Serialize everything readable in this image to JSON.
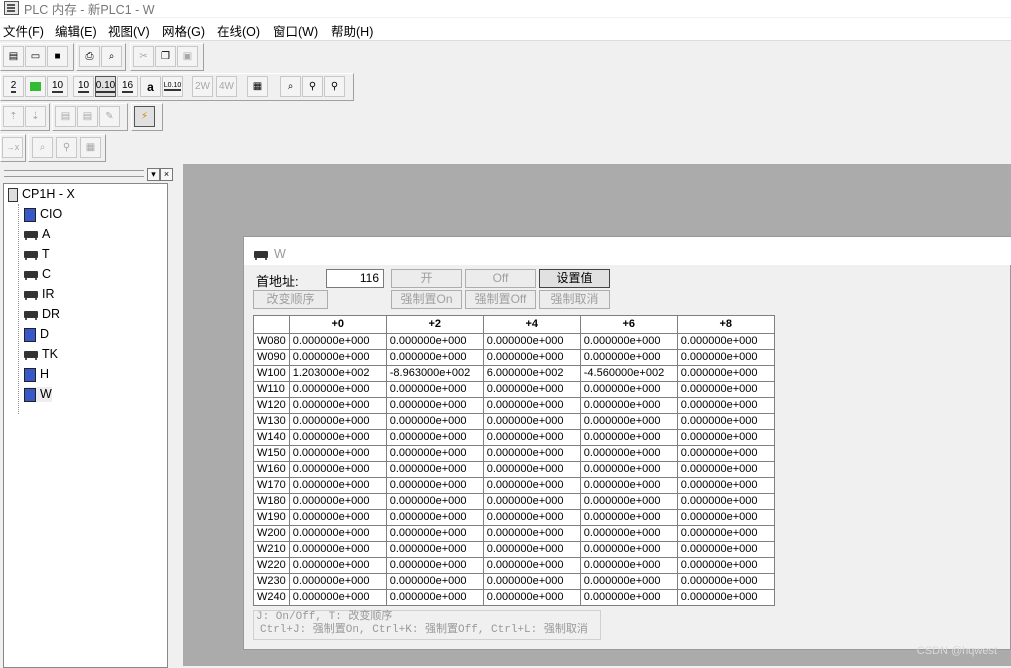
{
  "window": {
    "title": "PLC 内存 - 新PLC1 - W"
  },
  "menu": [
    "文件(F)",
    "编辑(E)",
    "视图(V)",
    "网格(G)",
    "在线(O)",
    "窗口(W)",
    "帮助(H)"
  ],
  "toolbar_row2": {
    "b1": "2",
    "b3": "10",
    "b4": "10",
    "b5": "0.10",
    "b6": "16",
    "b7": "a",
    "b8": "L0.10",
    "b9": "2W",
    "b10": "4W"
  },
  "tree": {
    "root": "CP1H - X",
    "items": [
      "CIO",
      "A",
      "T",
      "C",
      "IR",
      "DR",
      "D",
      "TK",
      "H",
      "W"
    ]
  },
  "child": {
    "title": "W",
    "start_label": "首地址:",
    "start_value": "116",
    "btn_on": "开",
    "btn_off": "Off",
    "btn_set": "设置值",
    "btn_order": "改变顺序",
    "btn_force_on": "强制置On",
    "btn_force_off": "强制置Off",
    "btn_force_cancel": "强制取消"
  },
  "grid": {
    "columns": [
      "+0",
      "+2",
      "+4",
      "+6",
      "+8"
    ],
    "rows": [
      {
        "addr": "W080",
        "v": [
          "0.000000e+000",
          "0.000000e+000",
          "0.000000e+000",
          "0.000000e+000",
          "0.000000e+000"
        ]
      },
      {
        "addr": "W090",
        "v": [
          "0.000000e+000",
          "0.000000e+000",
          "0.000000e+000",
          "0.000000e+000",
          "0.000000e+000"
        ]
      },
      {
        "addr": "W100",
        "v": [
          "1.203000e+002",
          "-8.963000e+002",
          "6.000000e+002",
          "-4.560000e+002",
          "0.000000e+000"
        ]
      },
      {
        "addr": "W110",
        "v": [
          "0.000000e+000",
          "0.000000e+000",
          "0.000000e+000",
          "0.000000e+000",
          "0.000000e+000"
        ]
      },
      {
        "addr": "W120",
        "v": [
          "0.000000e+000",
          "0.000000e+000",
          "0.000000e+000",
          "0.000000e+000",
          "0.000000e+000"
        ]
      },
      {
        "addr": "W130",
        "v": [
          "0.000000e+000",
          "0.000000e+000",
          "0.000000e+000",
          "0.000000e+000",
          "0.000000e+000"
        ]
      },
      {
        "addr": "W140",
        "v": [
          "0.000000e+000",
          "0.000000e+000",
          "0.000000e+000",
          "0.000000e+000",
          "0.000000e+000"
        ]
      },
      {
        "addr": "W150",
        "v": [
          "0.000000e+000",
          "0.000000e+000",
          "0.000000e+000",
          "0.000000e+000",
          "0.000000e+000"
        ]
      },
      {
        "addr": "W160",
        "v": [
          "0.000000e+000",
          "0.000000e+000",
          "0.000000e+000",
          "0.000000e+000",
          "0.000000e+000"
        ]
      },
      {
        "addr": "W170",
        "v": [
          "0.000000e+000",
          "0.000000e+000",
          "0.000000e+000",
          "0.000000e+000",
          "0.000000e+000"
        ]
      },
      {
        "addr": "W180",
        "v": [
          "0.000000e+000",
          "0.000000e+000",
          "0.000000e+000",
          "0.000000e+000",
          "0.000000e+000"
        ]
      },
      {
        "addr": "W190",
        "v": [
          "0.000000e+000",
          "0.000000e+000",
          "0.000000e+000",
          "0.000000e+000",
          "0.000000e+000"
        ]
      },
      {
        "addr": "W200",
        "v": [
          "0.000000e+000",
          "0.000000e+000",
          "0.000000e+000",
          "0.000000e+000",
          "0.000000e+000"
        ]
      },
      {
        "addr": "W210",
        "v": [
          "0.000000e+000",
          "0.000000e+000",
          "0.000000e+000",
          "0.000000e+000",
          "0.000000e+000"
        ]
      },
      {
        "addr": "W220",
        "v": [
          "0.000000e+000",
          "0.000000e+000",
          "0.000000e+000",
          "0.000000e+000",
          "0.000000e+000"
        ]
      },
      {
        "addr": "W230",
        "v": [
          "0.000000e+000",
          "0.000000e+000",
          "0.000000e+000",
          "0.000000e+000",
          "0.000000e+000"
        ]
      },
      {
        "addr": "W240",
        "v": [
          "0.000000e+000",
          "0.000000e+000",
          "0.000000e+000",
          "0.000000e+000",
          "0.000000e+000"
        ]
      }
    ]
  },
  "help": {
    "line1": "J: On/Off,    T: 改变顺序",
    "line2": "Ctrl+J: 强制置On,   Ctrl+K:  强制置Off,   Ctrl+L: 强制取消"
  },
  "watermark": "CSDN @hqwest"
}
